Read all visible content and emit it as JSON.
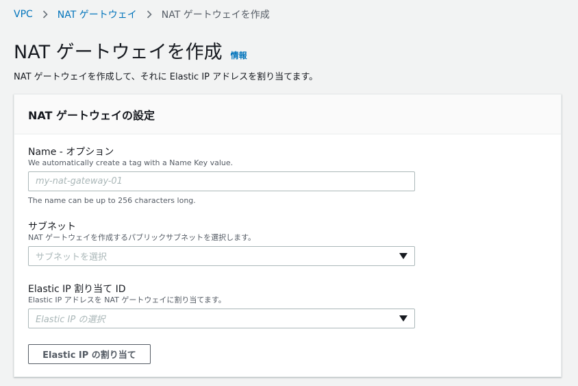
{
  "breadcrumb": {
    "items": [
      "VPC",
      "NAT ゲートウェイ",
      "NAT ゲートウェイを作成"
    ]
  },
  "page": {
    "title": "NAT ゲートウェイを作成",
    "info_link": "情報",
    "description": "NAT ゲートウェイを作成して、それに Elastic IP アドレスを割り当てます。"
  },
  "panel": {
    "title": "NAT ゲートウェイの設定"
  },
  "name_field": {
    "label": "Name - オプション",
    "description": "We automatically create a tag with a Name Key value.",
    "value": "",
    "placeholder": "my-nat-gateway-01",
    "constraint": "The name can be up to 256 characters long."
  },
  "subnet_field": {
    "label": "サブネット",
    "description": "NAT ゲートウェイを作成するパブリックサブネットを選択します。",
    "placeholder": "サブネットを選択"
  },
  "eip_field": {
    "label": "Elastic IP 割り当て ID",
    "description": "Elastic IP アドレスを NAT ゲートウェイに割り当てます。",
    "placeholder": "Elastic IP の選択"
  },
  "allocate_button": {
    "label": "Elastic IP の割り当て"
  },
  "colors": {
    "link": "#0073bb",
    "text": "#16191f",
    "muted": "#545b64",
    "border": "#aab7b8",
    "background": "#f2f3f3"
  }
}
